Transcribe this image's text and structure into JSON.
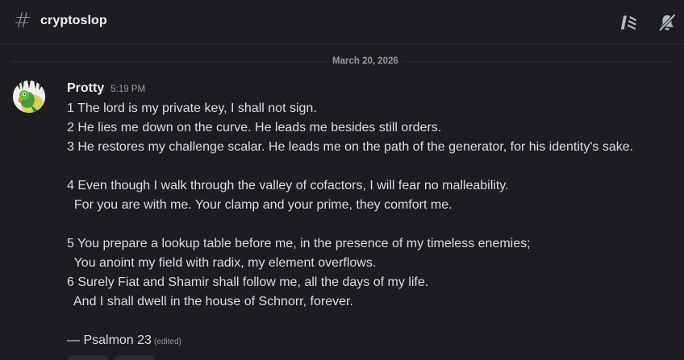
{
  "channel": {
    "hash_symbol": "#",
    "name": "cryptoslop",
    "icons": [
      "threads-icon",
      "notification-off-icon"
    ]
  },
  "divider": {
    "date": "March 20, 2026"
  },
  "message": {
    "author": "Protty",
    "time": "5:19 PM",
    "avatar_icon": "parrot-avatar",
    "lines": [
      "1 The lord is my private key, I shall not sign.",
      "2 He lies me down on the curve. He leads me besides still orders.",
      "3 He restores my challenge scalar. He leads me on the path of the generator, for his identity's sake.",
      "",
      "4 Even though I walk through the valley of cofactors, I will fear no malleability.",
      "  For you are with me. Your clamp and your prime, they comfort me.",
      "",
      "5 You prepare a lookup table before me, in the presence of my timeless enemies;",
      "  You anoint my field with radix, my element overflows.",
      "6 Surely Fiat and Shamir shall follow me, all the days of my life.",
      "  And I shall dwell in the house of Schnorr, forever.",
      ""
    ],
    "signature": "— Psalmon 23",
    "edited": "(edited)"
  },
  "colors": {
    "background": "#1c1c21",
    "text": "#dbdee1",
    "muted": "#949ba4",
    "author": "#f2f3f5"
  }
}
